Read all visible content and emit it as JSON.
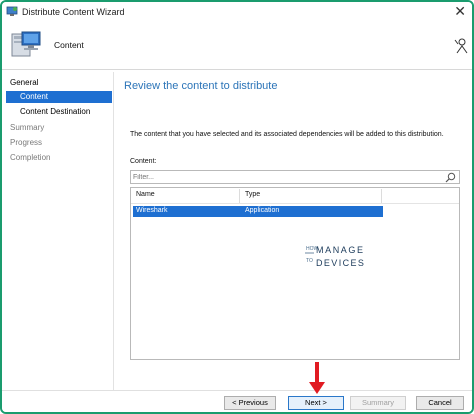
{
  "window": {
    "title": "Distribute Content Wizard",
    "close_glyph": "✕"
  },
  "header": {
    "title": "Content",
    "icon": "computer-icon",
    "help_icon": "help-person-icon"
  },
  "nav": {
    "group_label": "General",
    "items": [
      {
        "label": "Content",
        "state": "selected"
      },
      {
        "label": "Content Destination",
        "state": "normal"
      },
      {
        "label": "Summary",
        "state": "dim"
      },
      {
        "label": "Progress",
        "state": "dim"
      },
      {
        "label": "Completion",
        "state": "dim"
      }
    ]
  },
  "main": {
    "title": "Review the content to distribute",
    "description": "The content that you have selected and its associated dependencies will be added to this distribution.",
    "content_label": "Content:",
    "filter_placeholder": "Filter...",
    "columns": [
      "Name",
      "Type"
    ],
    "rows": [
      {
        "name": "Wireshark",
        "type": "Application",
        "selected": true
      }
    ]
  },
  "watermark": {
    "line1": "HOW",
    "line2": "TO",
    "line3": "MANAGE",
    "line4": "DEVICES"
  },
  "footer": {
    "previous_label": "< Previous",
    "next_label": "Next >",
    "summary_label": "Summary",
    "cancel_label": "Cancel"
  },
  "colors": {
    "accent": "#1e6fd1",
    "title_blue": "#2b74b8",
    "frame_green": "#1a9c6e",
    "annotation_red": "#e11b22"
  }
}
